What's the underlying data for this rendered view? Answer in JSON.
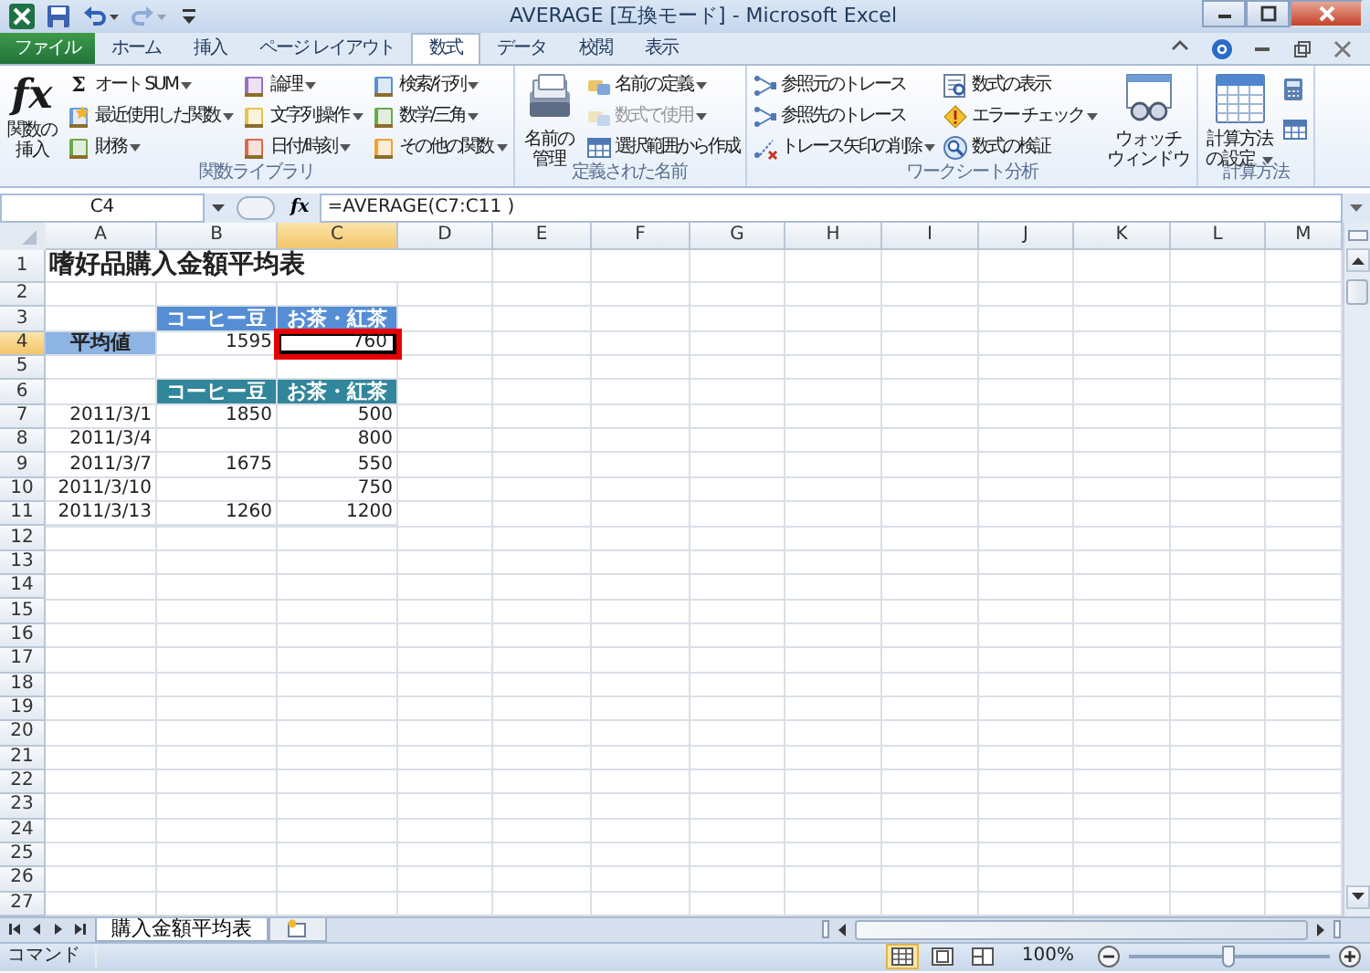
{
  "window": {
    "title": "AVERAGE [互換モード] - Microsoft Excel"
  },
  "quick_access": [
    {
      "kind": "save",
      "dropdown": false,
      "disabled": false
    },
    {
      "kind": "undo",
      "dropdown": true,
      "disabled": false
    },
    {
      "kind": "redo",
      "dropdown": true,
      "disabled": true
    },
    {
      "kind": "customize",
      "dropdown": false,
      "disabled": false
    }
  ],
  "ribbon_tabs": [
    {
      "label": "ファイル",
      "kind": "file",
      "selected": false
    },
    {
      "label": "ホーム",
      "kind": "tab",
      "selected": false
    },
    {
      "label": "挿入",
      "kind": "tab",
      "selected": false
    },
    {
      "label": "ページ レイアウト",
      "kind": "tab",
      "selected": false
    },
    {
      "label": "数式",
      "kind": "tab",
      "selected": true
    },
    {
      "label": "データ",
      "kind": "tab",
      "selected": false
    },
    {
      "label": "校閲",
      "kind": "tab",
      "selected": false
    },
    {
      "label": "表示",
      "kind": "tab",
      "selected": false
    }
  ],
  "ribbon_groups": [
    {
      "label": "関数ライブラリ",
      "sections": [
        {
          "kind": "large",
          "lines": [
            "関数の",
            "挿入"
          ],
          "glyph": "fx",
          "dropdown": false
        },
        {
          "kind": "column",
          "items": [
            {
              "label": "オート SUM",
              "glyph": "Σ",
              "dropdown": true,
              "disabled": false
            },
            {
              "label": "最近使用した関数",
              "dropdown": true,
              "disabled": false
            },
            {
              "label": "財務",
              "dropdown": true,
              "disabled": false
            }
          ]
        },
        {
          "kind": "column",
          "items": [
            {
              "label": "論理",
              "dropdown": true,
              "disabled": false
            },
            {
              "label": "文字列操作",
              "dropdown": true,
              "disabled": false
            },
            {
              "label": "日付/時刻",
              "dropdown": true,
              "disabled": false
            }
          ]
        },
        {
          "kind": "column",
          "items": [
            {
              "label": "検索/行列",
              "dropdown": true,
              "disabled": false
            },
            {
              "label": "数学/三角",
              "dropdown": true,
              "disabled": false
            },
            {
              "label": "その他の関数",
              "dropdown": true,
              "disabled": false
            }
          ]
        }
      ]
    },
    {
      "label": "定義された名前",
      "sections": [
        {
          "kind": "large",
          "lines": [
            "名前の",
            "管理"
          ],
          "dropdown": false
        },
        {
          "kind": "column",
          "items": [
            {
              "label": "名前の定義",
              "dropdown": true,
              "disabled": false
            },
            {
              "label": "数式で使用",
              "dropdown": true,
              "disabled": true
            },
            {
              "label": "選択範囲から作成",
              "dropdown": false,
              "disabled": false
            }
          ]
        }
      ]
    },
    {
      "label": "ワークシート分析",
      "sections": [
        {
          "kind": "column",
          "items": [
            {
              "label": "参照元のトレース",
              "dropdown": false,
              "disabled": false
            },
            {
              "label": "参照先のトレース",
              "dropdown": false,
              "disabled": false
            },
            {
              "label": "トレース矢印の削除",
              "dropdown": true,
              "disabled": false
            }
          ]
        },
        {
          "kind": "column",
          "items": [
            {
              "label": "数式の表示",
              "dropdown": false,
              "disabled": false
            },
            {
              "label": "エラー チェック",
              "dropdown": true,
              "disabled": false
            },
            {
              "label": "数式の検証",
              "dropdown": false,
              "disabled": false
            }
          ]
        },
        {
          "kind": "large",
          "lines": [
            "ウォッチ",
            "ウィンドウ"
          ],
          "dropdown": false
        }
      ]
    },
    {
      "label": "計算方法",
      "sections": [
        {
          "kind": "large",
          "lines": [
            "計算方法",
            "の設定"
          ],
          "dropdown": true
        },
        {
          "kind": "icons"
        }
      ]
    }
  ],
  "formula_bar": {
    "name_box": "C4",
    "fx": "fx",
    "formula": "=AVERAGE(C7:C11 )"
  },
  "columns": [
    "A",
    "B",
    "C",
    "D",
    "E",
    "F",
    "G",
    "H",
    "I",
    "J",
    "K",
    "L",
    "M"
  ],
  "rows": [
    {
      "number": "1",
      "cells": {
        "A": {
          "text": "嗜好品購入金額平均表",
          "kind": "title",
          "selected": false,
          "highlighted": false
        }
      }
    },
    {
      "number": "2"
    },
    {
      "number": "3",
      "cells": {
        "B": {
          "text": "コーヒー豆",
          "kind": "header-blue",
          "selected": false,
          "highlighted": false
        },
        "C": {
          "text": "お茶・紅茶",
          "kind": "header-blue",
          "selected": false,
          "highlighted": false
        }
      }
    },
    {
      "number": "4",
      "cells": {
        "A": {
          "text": "平均値",
          "kind": "label",
          "selected": false,
          "highlighted": false
        },
        "B": {
          "text": "1595",
          "kind": "number",
          "selected": false,
          "highlighted": false
        },
        "C": {
          "text": "760",
          "kind": "number",
          "selected": true,
          "highlighted": true
        }
      }
    },
    {
      "number": "5"
    },
    {
      "number": "6",
      "cells": {
        "B": {
          "text": "コーヒー豆",
          "kind": "header-teal",
          "selected": false,
          "highlighted": false
        },
        "C": {
          "text": "お茶・紅茶",
          "kind": "header-teal",
          "selected": false,
          "highlighted": false
        }
      }
    },
    {
      "number": "7",
      "cells": {
        "A": {
          "text": "2011/3/1",
          "kind": "date",
          "selected": false,
          "highlighted": false
        },
        "B": {
          "text": "1850",
          "kind": "number",
          "selected": false,
          "highlighted": false
        },
        "C": {
          "text": "500",
          "kind": "number",
          "selected": false,
          "highlighted": false
        }
      }
    },
    {
      "number": "8",
      "cells": {
        "A": {
          "text": "2011/3/4",
          "kind": "date",
          "selected": false,
          "highlighted": false
        },
        "C": {
          "text": "800",
          "kind": "number",
          "selected": false,
          "highlighted": false
        }
      }
    },
    {
      "number": "9",
      "cells": {
        "A": {
          "text": "2011/3/7",
          "kind": "date",
          "selected": false,
          "highlighted": false
        },
        "B": {
          "text": "1675",
          "kind": "number",
          "selected": false,
          "highlighted": false
        },
        "C": {
          "text": "550",
          "kind": "number",
          "selected": false,
          "highlighted": false
        }
      }
    },
    {
      "number": "10",
      "cells": {
        "A": {
          "text": "2011/3/10",
          "kind": "date",
          "selected": false,
          "highlighted": false
        },
        "C": {
          "text": "750",
          "kind": "number",
          "selected": false,
          "highlighted": false
        }
      }
    },
    {
      "number": "11",
      "cells": {
        "A": {
          "text": "2011/3/13",
          "kind": "date",
          "selected": false,
          "highlighted": false
        },
        "B": {
          "text": "1260",
          "kind": "number",
          "selected": false,
          "highlighted": false
        },
        "C": {
          "text": "1200",
          "kind": "number",
          "selected": false,
          "highlighted": false
        }
      }
    },
    {
      "number": "12"
    },
    {
      "number": "13"
    },
    {
      "number": "14"
    },
    {
      "number": "15"
    },
    {
      "number": "16"
    },
    {
      "number": "17"
    },
    {
      "number": "18"
    },
    {
      "number": "19"
    },
    {
      "number": "20"
    },
    {
      "number": "21"
    },
    {
      "number": "22"
    },
    {
      "number": "23"
    },
    {
      "number": "24"
    },
    {
      "number": "25"
    },
    {
      "number": "26"
    },
    {
      "number": "27"
    }
  ],
  "sheet_tabs": [
    {
      "label": "購入金額平均表",
      "selected": true
    }
  ],
  "status_bar": {
    "mode": "コマンド",
    "views": [
      {
        "kind": "normal",
        "selected": true
      },
      {
        "kind": "page-layout",
        "selected": false
      },
      {
        "kind": "page-break",
        "selected": false
      }
    ],
    "zoom": "100%",
    "zoom_slider": {
      "level": 0.5
    }
  }
}
